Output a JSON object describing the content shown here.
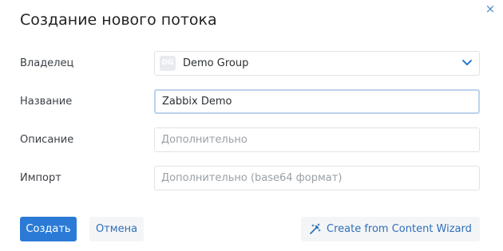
{
  "dialog": {
    "title": "Создание нового потока",
    "close_label": "×"
  },
  "form": {
    "owner": {
      "label": "Владелец",
      "avatar_initials": "DG",
      "value": "Demo Group"
    },
    "name": {
      "label": "Название",
      "value": "Zabbix Demo"
    },
    "description": {
      "label": "Описание",
      "placeholder": "Дополнительно"
    },
    "import": {
      "label": "Импорт",
      "placeholder": "Дополнительно (base64 формат)"
    }
  },
  "actions": {
    "create_label": "Создать",
    "cancel_label": "Отмена",
    "wizard_label": "Create from Content Wizard"
  },
  "icons": {
    "close": "close-icon",
    "chevron": "chevron-down-icon",
    "wizard": "magic-wand-icon"
  },
  "colors": {
    "primary": "#2b7bd6",
    "link": "#2d6fb8",
    "focus_border": "#bcd2ec"
  }
}
